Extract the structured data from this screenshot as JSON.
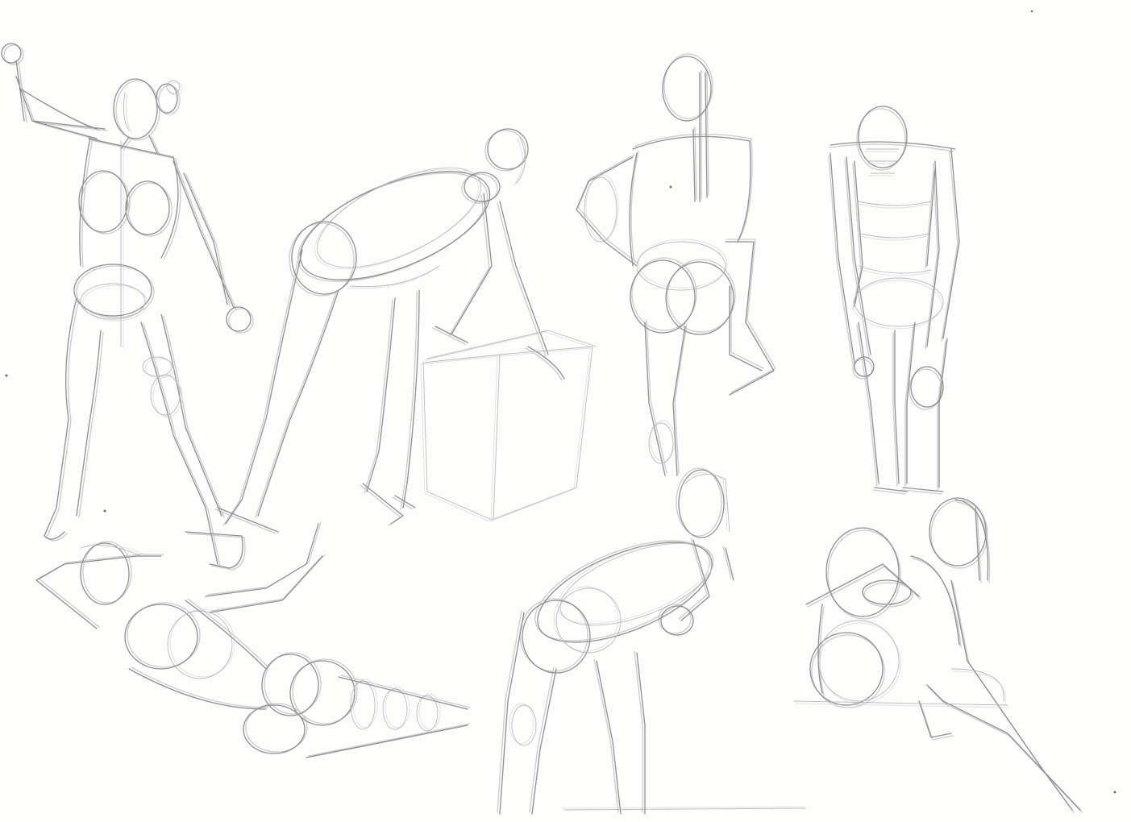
{
  "paper": {
    "background": "#fdfdfc",
    "stroke": "#8e8e8e",
    "stroke_light": "#b9b9b9",
    "speck": "#6a6a6a"
  }
}
